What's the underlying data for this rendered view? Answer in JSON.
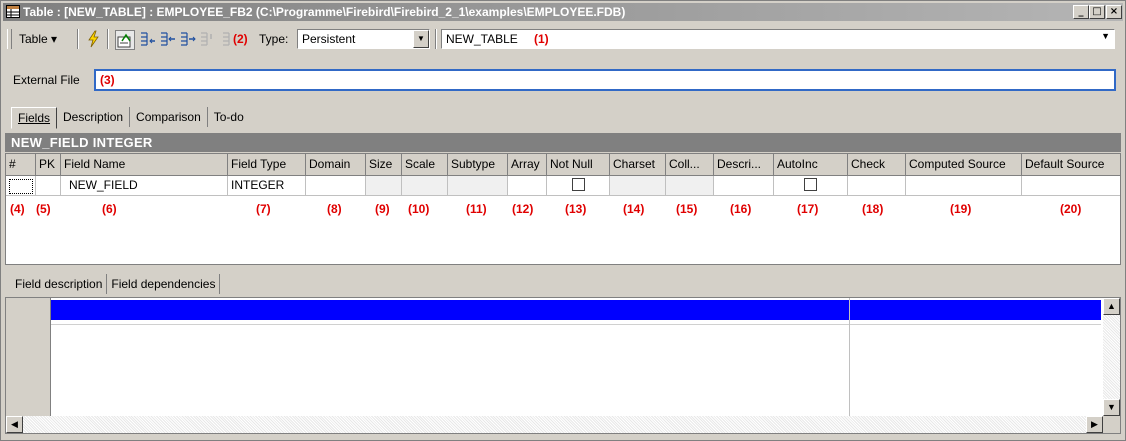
{
  "window": {
    "title": "Table : [NEW_TABLE] : EMPLOYEE_FB2 (C:\\Programme\\Firebird\\Firebird_2_1\\examples\\EMPLOYEE.FDB)",
    "min_glyph": "_",
    "max_glyph": "□",
    "close_glyph": "×"
  },
  "toolbar": {
    "table_menu": "Table ▾",
    "marker_2": "(2)",
    "type_label": "Type:",
    "type_value": "Persistent",
    "table_name": "NEW_TABLE",
    "marker_1": "(1)",
    "accent": "#e00000"
  },
  "external_file": {
    "label": "External File",
    "value": "(3)"
  },
  "tabs": [
    "Fields",
    "Description",
    "Comparison",
    "To-do"
  ],
  "band_title": "NEW_FIELD INTEGER",
  "grid": {
    "columns": [
      "#",
      "PK",
      "Field Name",
      "Field Type",
      "Domain",
      "Size",
      "Scale",
      "Subtype",
      "Array",
      "Not Null",
      "Charset",
      "Coll...",
      "Descri...",
      "AutoInc",
      "Check",
      "Computed Source",
      "Default Source"
    ],
    "row": {
      "field_name": "NEW_FIELD",
      "field_type": "INTEGER",
      "not_null": false,
      "autoinc": false
    },
    "markers": [
      "(4)",
      "(5)",
      "(6)",
      "(7)",
      "(8)",
      "(9)",
      "(10)",
      "(11)",
      "(12)",
      "(13)",
      "(14)",
      "(15)",
      "(16)",
      "(17)",
      "(18)",
      "(19)",
      "(20)"
    ]
  },
  "bottom_tabs": [
    "Field description",
    "Field dependencies"
  ],
  "colors": {
    "selection": "#0000ff",
    "focus_border": "#3169c6"
  }
}
